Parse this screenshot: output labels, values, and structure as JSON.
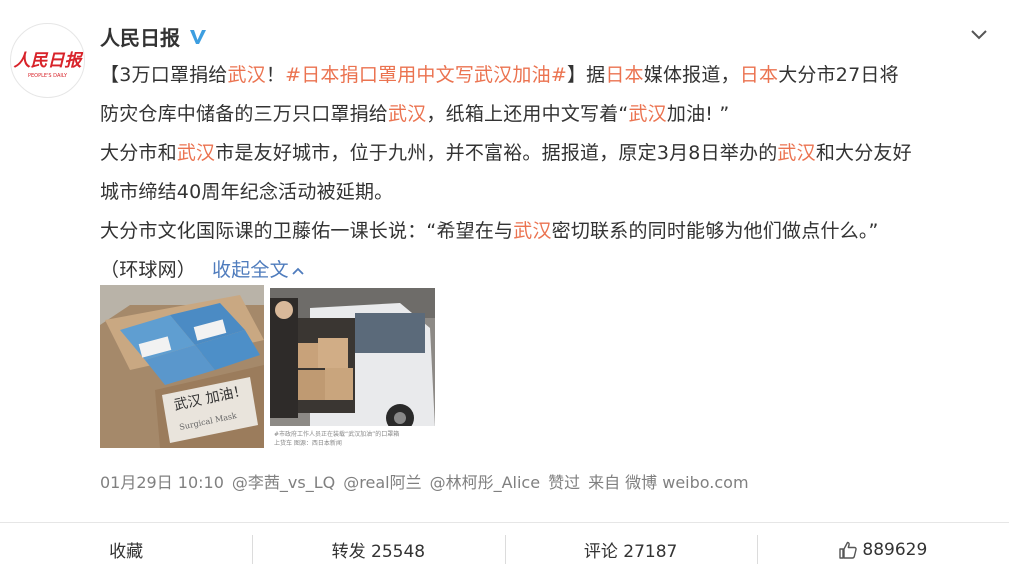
{
  "post": {
    "username": "人民日报",
    "avatar_text": "人民日报",
    "avatar_subtext": "PEOPLE'S DAILY",
    "verified_icon": "verified-v-icon",
    "content": {
      "line1": {
        "a": "【3万口罩捐给",
        "b": "武汉",
        "c": "！",
        "tag": "#日本捐口罩用中文写武汉加油#",
        "d": "】据",
        "e": "日本",
        "f": "媒体报道，",
        "g": "日本",
        "h": "大分市27日将"
      },
      "line2": {
        "a": "防灾仓库中储备的三万只口罩捐给",
        "b": "武汉",
        "c": "，纸箱上还用中文写着“",
        "d": "武汉",
        "e": "加油! ”"
      },
      "line3": {
        "a": "大分市和",
        "b": "武汉",
        "c": "市是友好城市，位于九州，并不富裕。据报道，原定3月8日举办的",
        "d": "武汉",
        "e": "和大分友好"
      },
      "line4": "城市缔结40周年纪念活动被延期。",
      "line5": {
        "a": "大分市文化国际课的卫藤佑一课长说：“希望在与",
        "b": "武汉",
        "c": "密切联系的同时能够为他们做点什么。”"
      },
      "line6": "（环球网）",
      "collapse_label": "收起全文"
    },
    "images": {
      "box_label": "武汉 加油！",
      "box_sublabel": "Surgical Mask",
      "caption1": "#市政府工作人员正在装载“武汉加油”的口罩箱",
      "caption2": "上货车 图源：西日本新闻"
    },
    "meta": {
      "time": "01月29日 10:10",
      "liker1": "@李茜_vs_LQ",
      "liker2": "@real阿兰",
      "liker3": "@林柯彤_Alice",
      "liked_text": "赞过",
      "source": "来自 微博 weibo.com"
    }
  },
  "actions": {
    "favorite": "收藏",
    "repost": "转发 25548",
    "comment": "评论 27187",
    "like_count": "889629"
  },
  "colors": {
    "highlight": "#eb7350",
    "link": "#4f7cbd",
    "verified": "#3d9ee0",
    "avatar_red": "#d8232a"
  }
}
